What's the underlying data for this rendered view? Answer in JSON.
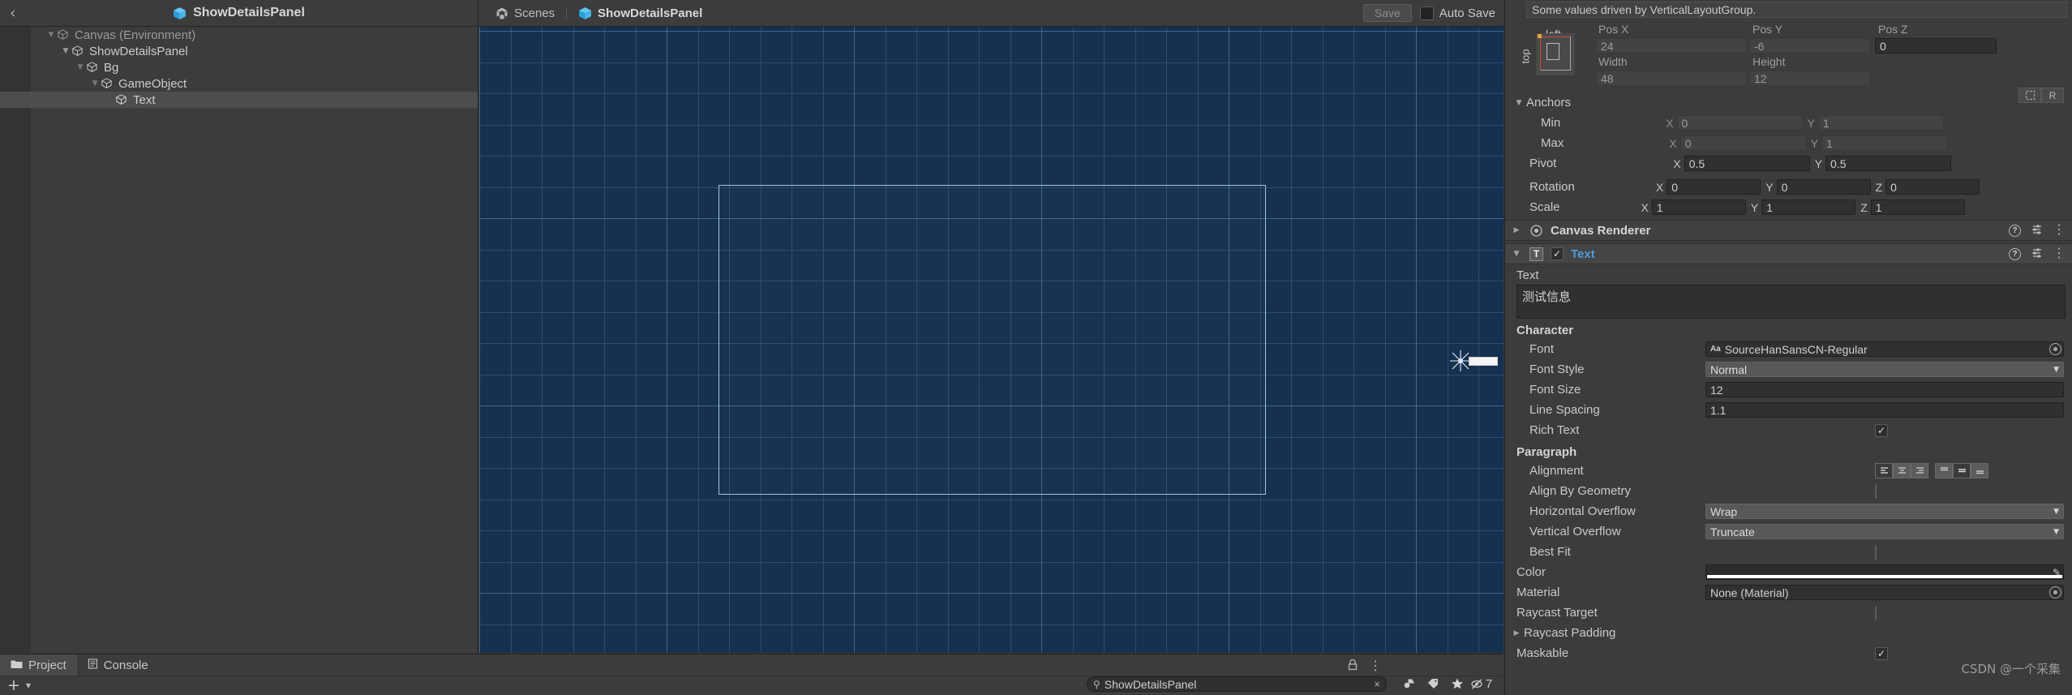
{
  "hierarchy": {
    "tab_title": "ShowDetailsPanel",
    "back_icon": "back-chevron-icon",
    "items": [
      {
        "label": "Canvas (Environment)",
        "depth": 0,
        "expanded": true,
        "selected": false,
        "faded": true
      },
      {
        "label": "ShowDetailsPanel",
        "depth": 1,
        "expanded": true,
        "selected": false,
        "faded": false
      },
      {
        "label": "Bg",
        "depth": 2,
        "expanded": true,
        "selected": false,
        "faded": false
      },
      {
        "label": "GameObject",
        "depth": 3,
        "expanded": true,
        "selected": false,
        "faded": false
      },
      {
        "label": "Text",
        "depth": 4,
        "expanded": false,
        "selected": true,
        "faded": false
      }
    ]
  },
  "scene": {
    "tabs": [
      {
        "label": "Scenes",
        "icon": "unity-scene-icon",
        "active": false
      },
      {
        "label": "ShowDetailsPanel",
        "icon": "cube-icon",
        "active": true
      }
    ],
    "save_label": "Save",
    "auto_save_label": "Auto Save",
    "auto_save_checked": false,
    "background_color": "#16304f"
  },
  "inspector": {
    "driven_note": "Some values driven by VerticalLayoutGroup.",
    "rect_transform": {
      "anchor_preset_label_left": "left",
      "anchor_preset_label_top": "top",
      "pos_x_label": "Pos X",
      "pos_x_value": "24",
      "pos_y_label": "Pos Y",
      "pos_y_value": "-6",
      "pos_z_label": "Pos Z",
      "pos_z_value": "0",
      "width_label": "Width",
      "width_value": "48",
      "height_label": "Height",
      "height_value": "12",
      "blueprint_btn": "blueprint-mode-icon",
      "raw_btn": "R"
    },
    "anchors": {
      "title": "Anchors",
      "min_label": "Min",
      "min_x": "0",
      "min_y": "1",
      "max_label": "Max",
      "max_x": "0",
      "max_y": "1",
      "pivot_label": "Pivot",
      "pivot_x": "0.5",
      "pivot_y": "0.5",
      "rotation_label": "Rotation",
      "rot_x": "0",
      "rot_y": "0",
      "rot_z": "0",
      "scale_label": "Scale",
      "scale_x": "1",
      "scale_y": "1",
      "scale_z": "1",
      "cap_x": "X",
      "cap_y": "Y",
      "cap_z": "Z"
    },
    "components": [
      {
        "title": "Canvas Renderer",
        "expanded": false,
        "has_checkbox": false,
        "icon": "canvas-renderer-eye-icon"
      },
      {
        "title": "Text",
        "expanded": true,
        "has_checkbox": true,
        "checked": true,
        "icon": "text-component-icon"
      }
    ],
    "text_component": {
      "text_label": "Text",
      "text_value": "测试信息",
      "character_title": "Character",
      "font_label": "Font",
      "font_value": "SourceHanSansCN-Regular",
      "font_style_label": "Font Style",
      "font_style_value": "Normal",
      "font_size_label": "Font Size",
      "font_size_value": "12",
      "line_spacing_label": "Line Spacing",
      "line_spacing_value": "1.1",
      "rich_text_label": "Rich Text",
      "rich_text_checked": true,
      "paragraph_title": "Paragraph",
      "alignment_label": "Alignment",
      "alignment_horizontal": "left",
      "alignment_vertical": "middle",
      "align_by_geometry_label": "Align By Geometry",
      "align_by_geometry_checked": false,
      "horizontal_overflow_label": "Horizontal Overflow",
      "horizontal_overflow_value": "Wrap",
      "vertical_overflow_label": "Vertical Overflow",
      "vertical_overflow_value": "Truncate",
      "best_fit_label": "Best Fit",
      "best_fit_checked": false,
      "color_label": "Color",
      "color_value": "#FFFFFF",
      "material_label": "Material",
      "material_value": "None (Material)",
      "raycast_target_label": "Raycast Target",
      "raycast_target_checked": false,
      "raycast_padding_label": "Raycast Padding",
      "maskable_label": "Maskable",
      "maskable_checked": true
    },
    "watermark": "CSDN @一个采集"
  },
  "bottom": {
    "tabs": [
      {
        "label": "Project",
        "icon": "folder-icon",
        "active": true
      },
      {
        "label": "Console",
        "icon": "console-icon",
        "active": false
      }
    ],
    "add_label": "+",
    "search_value": "ShowDetailsPanel",
    "search_clear": "×",
    "filter_icons": [
      "type-filter-icon",
      "label-filter-icon",
      "favorite-star-icon",
      "visibility-off-icon"
    ],
    "visibility_count": "7",
    "lock_icon": "lock-icon",
    "menu_icon": "kebab-menu-icon"
  }
}
